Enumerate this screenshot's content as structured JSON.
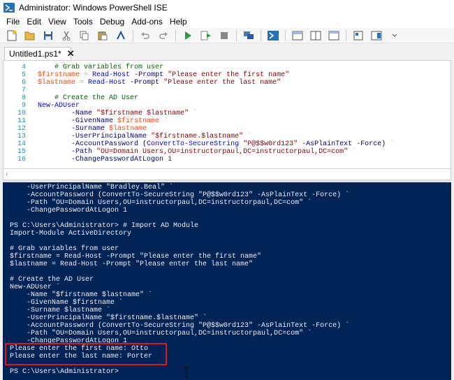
{
  "window": {
    "title": "Administrator: Windows PowerShell ISE"
  },
  "menu": [
    "File",
    "Edit",
    "View",
    "Tools",
    "Debug",
    "Add-ons",
    "Help"
  ],
  "toolbar": {
    "icons": [
      "new-file-icon",
      "open-icon",
      "save-icon",
      "cut-icon",
      "copy-icon",
      "paste-icon",
      "clear-console-icon",
      "undo-icon",
      "redo-icon",
      "run-icon",
      "run-selection-icon",
      "stop-icon",
      "remote-icon",
      "powershell-icon",
      "layout-top-icon",
      "layout-right-icon",
      "layout-max-icon",
      "commands-icon",
      "addon-icon"
    ]
  },
  "tab": {
    "label": "Untitled1.ps1*",
    "close": "✕"
  },
  "editor": {
    "lines": [
      {
        "n": "4",
        "spans": [
          [
            "c-plain",
            "    "
          ],
          [
            "c-comment",
            "# Grab variables from user"
          ]
        ]
      },
      {
        "n": "5",
        "spans": [
          [
            "c-var",
            "$firstname"
          ],
          [
            "c-op",
            " = "
          ],
          [
            "c-cmd",
            "Read-Host"
          ],
          [
            "c-plain",
            " "
          ],
          [
            "c-param",
            "-Prompt"
          ],
          [
            "c-plain",
            " "
          ],
          [
            "c-str",
            "\"Please enter the first name\""
          ]
        ]
      },
      {
        "n": "6",
        "spans": [
          [
            "c-var",
            "$lastname"
          ],
          [
            "c-op",
            " = "
          ],
          [
            "c-cmd",
            "Read-Host"
          ],
          [
            "c-plain",
            " "
          ],
          [
            "c-param",
            "-Prompt"
          ],
          [
            "c-plain",
            " "
          ],
          [
            "c-str",
            "\"Please enter the last name\""
          ]
        ]
      },
      {
        "n": "7",
        "spans": []
      },
      {
        "n": "8",
        "spans": [
          [
            "c-plain",
            "    "
          ],
          [
            "c-comment",
            "# Create the AD User"
          ]
        ]
      },
      {
        "n": "9",
        "spans": [
          [
            "c-cmd",
            "New-ADUser"
          ],
          [
            "c-tick",
            " `"
          ]
        ]
      },
      {
        "n": "10",
        "spans": [
          [
            "c-plain",
            "        "
          ],
          [
            "c-param",
            "-Name"
          ],
          [
            "c-plain",
            " "
          ],
          [
            "c-str",
            "\"$firstname $lastname\""
          ],
          [
            "c-tick",
            " `"
          ]
        ]
      },
      {
        "n": "11",
        "spans": [
          [
            "c-plain",
            "        "
          ],
          [
            "c-param",
            "-GivenName"
          ],
          [
            "c-plain",
            " "
          ],
          [
            "c-var",
            "$firstname"
          ],
          [
            "c-tick",
            " `"
          ]
        ]
      },
      {
        "n": "12",
        "spans": [
          [
            "c-plain",
            "        "
          ],
          [
            "c-param",
            "-Surname"
          ],
          [
            "c-plain",
            " "
          ],
          [
            "c-var",
            "$lastname"
          ],
          [
            "c-tick",
            " `"
          ]
        ]
      },
      {
        "n": "13",
        "spans": [
          [
            "c-plain",
            "        "
          ],
          [
            "c-param",
            "-UserPrincipalName"
          ],
          [
            "c-plain",
            " "
          ],
          [
            "c-str",
            "\"$firstname.$lastname\""
          ],
          [
            "c-tick",
            " `"
          ]
        ]
      },
      {
        "n": "14",
        "spans": [
          [
            "c-plain",
            "        "
          ],
          [
            "c-param",
            "-AccountPassword"
          ],
          [
            "c-plain",
            " ("
          ],
          [
            "c-cmd",
            "ConvertTo-SecureString"
          ],
          [
            "c-plain",
            " "
          ],
          [
            "c-str",
            "\"P@$$w0rd123\""
          ],
          [
            "c-plain",
            " "
          ],
          [
            "c-param",
            "-AsPlainText"
          ],
          [
            "c-plain",
            " "
          ],
          [
            "c-param",
            "-Force"
          ],
          [
            "c-plain",
            ")"
          ],
          [
            "c-tick",
            " `"
          ]
        ]
      },
      {
        "n": "15",
        "spans": [
          [
            "c-plain",
            "        "
          ],
          [
            "c-param",
            "-Path"
          ],
          [
            "c-plain",
            " "
          ],
          [
            "c-str",
            "\"OU=Domain Users,OU=instructorpaul,DC=instructorpaul,DC=com\""
          ],
          [
            "c-tick",
            " `"
          ]
        ]
      },
      {
        "n": "16",
        "spans": [
          [
            "c-plain",
            "        "
          ],
          [
            "c-param",
            "-ChangePasswordAtLogon"
          ],
          [
            "c-plain",
            " "
          ],
          [
            "c-num",
            "1"
          ]
        ]
      }
    ]
  },
  "console": {
    "lines": [
      "    -UserPrincipalName \"Bradley.Beal\" `",
      "    -AccountPassword (ConvertTo-SecureString \"P@$$w0rd123\" -AsPlainText -Force) `",
      "    -Path \"OU=Domain Users,OU=instructorpaul,DC=instructorpaul,DC=com\" `",
      "    -ChangePasswordAtLogon 1",
      "",
      "PS C:\\Users\\Administrator> # Import AD Module",
      "Import-Module ActiveDirectory",
      "",
      "# Grab variables from user",
      "$firstname = Read-Host -Prompt \"Please enter the first name\"",
      "$lastname = Read-Host -Prompt \"Please enter the last name\"",
      "",
      "# Create the AD User",
      "New-ADUser `",
      "    -Name \"$firstname $lastname\" `",
      "    -GivenName $firstname `",
      "    -Surname $lastname `",
      "    -UserPrincipalName \"$firstname.$lastname\" `",
      "    -AccountPassword (ConvertTo-SecureString \"P@$$w0rd123\" -AsPlainText -Force) `",
      "    -Path \"OU=Domain Users,OU=instructorpaul,DC=instructorpaul,DC=com\" `",
      "    -ChangePasswordAtLogon 1",
      "Please enter the first name: Otto",
      "Please enter the last name: Porter",
      "",
      "PS C:\\Users\\Administrator>"
    ]
  },
  "colors": {
    "console_bg": "#012456",
    "highlight": "#e81123",
    "line_number": "#2b91af"
  }
}
